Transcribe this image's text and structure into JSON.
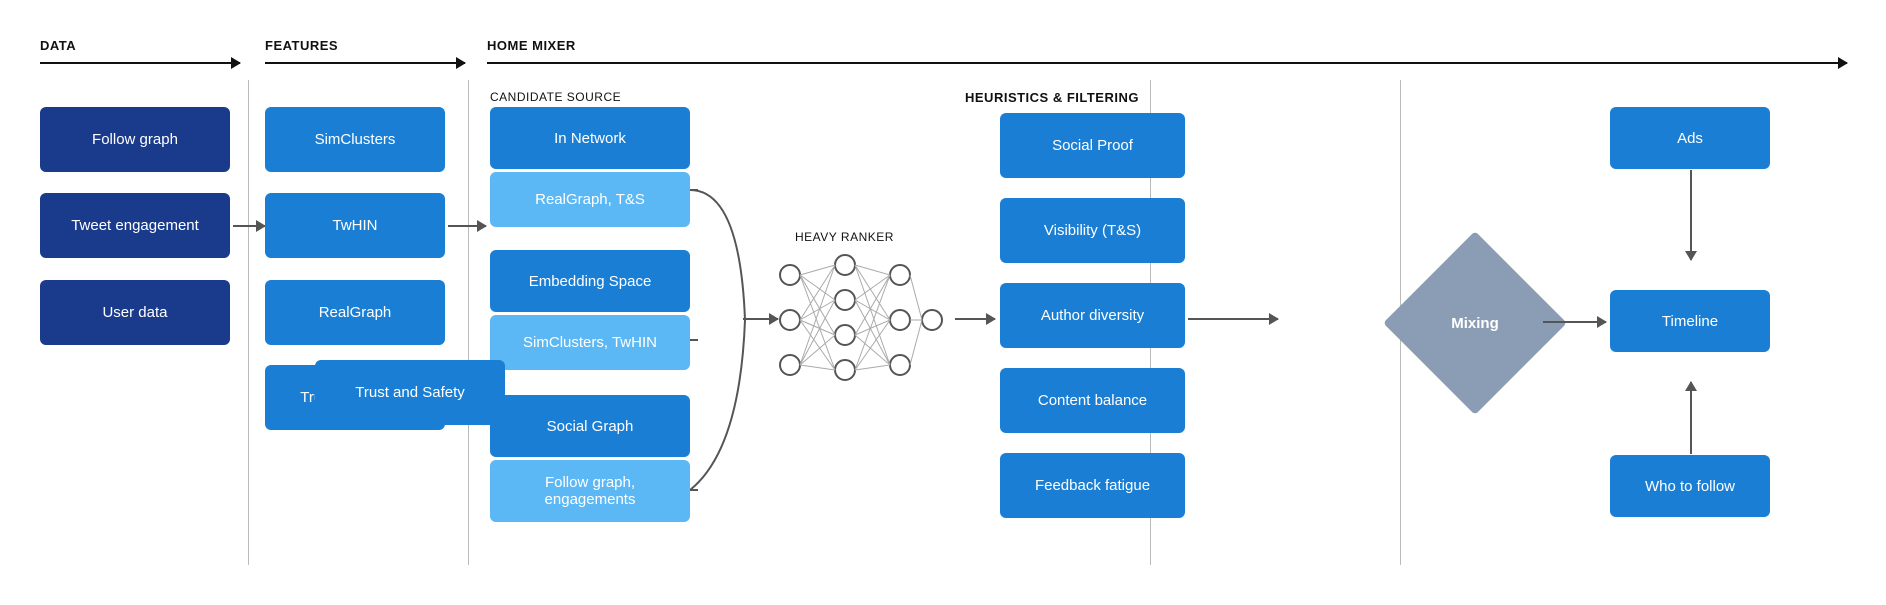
{
  "sections": {
    "data": "DATA",
    "features": "FEATURES",
    "homeMixer": "HOME MIXER",
    "heuristics": "HEURISTICS & FILTERING",
    "candidateSource": "CANDIDATE SOURCE",
    "heavyRanker": "HEAVY RANKER"
  },
  "data": {
    "followGraph": "Follow graph",
    "tweetEngagement": "Tweet engagement",
    "userData": "User data"
  },
  "features": {
    "simClusters": "SimClusters",
    "twhin": "TwHIN",
    "realGraph": "RealGraph",
    "trustSafety": "Trust and Safety",
    "trustSafety2": "Trust and Safety"
  },
  "candidateSource": {
    "inNetwork": "In Network",
    "realGraphTS": "RealGraph, T&S",
    "embeddingSpace": "Embedding Space",
    "simClustersTwhin": "SimClusters, TwHIN",
    "socialGraph": "Social Graph",
    "followGraphEngagements": "Follow graph, engagements"
  },
  "heuristics": {
    "socialProof": "Social Proof",
    "visibilityTS": "Visibility (T&S)",
    "authorDiversity": "Author diversity",
    "contentBalance": "Content balance",
    "feedbackFatigue": "Feedback fatigue"
  },
  "mixing": {
    "label": "Mixing"
  },
  "rightColumn": {
    "ads": "Ads",
    "timeline": "Timeline",
    "whoToFollow": "Who to follow"
  }
}
